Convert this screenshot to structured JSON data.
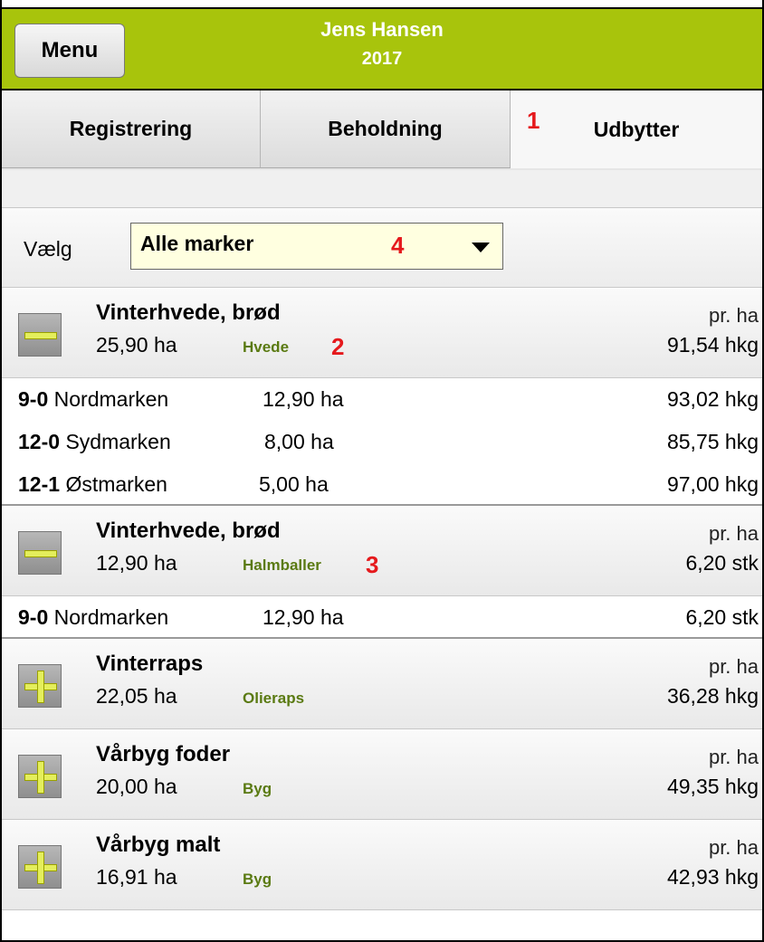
{
  "header": {
    "menu_label": "Menu",
    "name": "Jens Hansen",
    "year": "2017",
    "bg_color": "#a8c40c"
  },
  "tabs": [
    {
      "label": "Registrering",
      "active": false
    },
    {
      "label": "Beholdning",
      "active": false
    },
    {
      "label": "Udbytter",
      "active": true
    }
  ],
  "annotations": [
    "1",
    "2",
    "3",
    "4"
  ],
  "filter": {
    "label": "Vælg",
    "selected": "Alle marker"
  },
  "groups": [
    {
      "name": "Vinterhvede, brød",
      "area": "25,90 ha",
      "type": "Hvede",
      "per": "pr. ha",
      "yield": "91,54 hkg",
      "expanded": true,
      "rows": [
        {
          "code": "9-0",
          "field": "Nordmarken",
          "area": "12,90 ha",
          "yield": "93,02 hkg"
        },
        {
          "code": "12-0",
          "field": "Sydmarken",
          "area": "8,00 ha",
          "yield": "85,75 hkg"
        },
        {
          "code": "12-1",
          "field": "Østmarken",
          "area": "5,00 ha",
          "yield": "97,00 hkg"
        }
      ]
    },
    {
      "name": "Vinterhvede, brød",
      "area": "12,90 ha",
      "type": "Halmballer",
      "per": "pr. ha",
      "yield": "6,20 stk",
      "expanded": true,
      "rows": [
        {
          "code": "9-0",
          "field": "Nordmarken",
          "area": "12,90 ha",
          "yield": "6,20 stk"
        }
      ]
    },
    {
      "name": "Vinterraps",
      "area": "22,05 ha",
      "type": "Olieraps",
      "per": "pr. ha",
      "yield": "36,28 hkg",
      "expanded": false,
      "rows": []
    },
    {
      "name": "Vårbyg foder",
      "area": "20,00 ha",
      "type": "Byg",
      "per": "pr. ha",
      "yield": "49,35 hkg",
      "expanded": false,
      "rows": []
    },
    {
      "name": "Vårbyg malt",
      "area": "16,91 ha",
      "type": "Byg",
      "per": "pr. ha",
      "yield": "42,93 hkg",
      "expanded": false,
      "rows": []
    }
  ]
}
